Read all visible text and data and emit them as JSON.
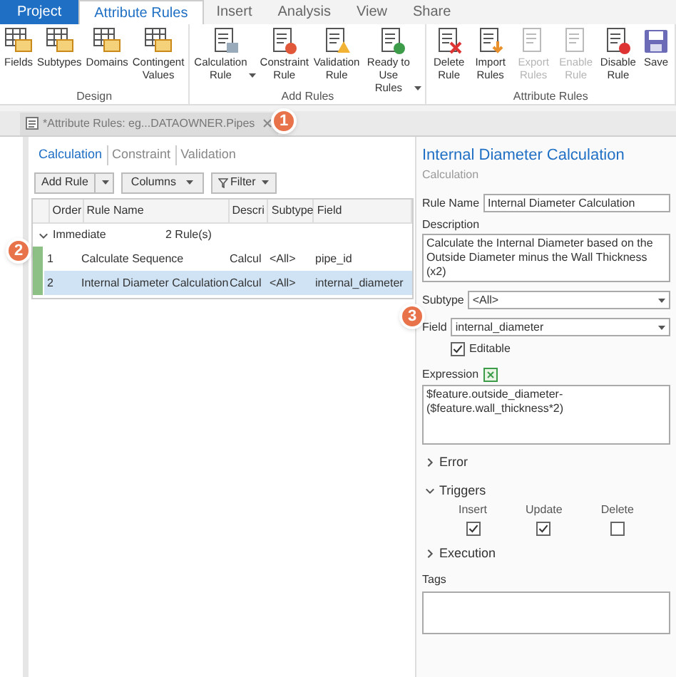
{
  "ribbon_tabs": [
    {
      "label": "Project",
      "selected": false,
      "kind": "file"
    },
    {
      "label": "Attribute Rules",
      "selected": true,
      "kind": "tab"
    },
    {
      "label": "Insert",
      "selected": false,
      "kind": "tab"
    },
    {
      "label": "Analysis",
      "selected": false,
      "kind": "tab"
    },
    {
      "label": "View",
      "selected": false,
      "kind": "tab"
    },
    {
      "label": "Share",
      "selected": false,
      "kind": "tab"
    }
  ],
  "ribbon_groups": [
    {
      "label": "Design",
      "buttons": [
        {
          "label": "Fields",
          "dropdown": false,
          "disabled": false
        },
        {
          "label": "Subtypes",
          "dropdown": false,
          "disabled": false
        },
        {
          "label": "Domains",
          "dropdown": false,
          "disabled": false
        },
        {
          "label": "Contingent Values",
          "dropdown": false,
          "disabled": false
        }
      ]
    },
    {
      "label": "Add Rules",
      "buttons": [
        {
          "label": "Calculation Rule",
          "dropdown": true,
          "disabled": false
        },
        {
          "label": "Constraint Rule",
          "dropdown": false,
          "disabled": false
        },
        {
          "label": "Validation Rule",
          "dropdown": false,
          "disabled": false
        },
        {
          "label": "Ready to Use Rules",
          "dropdown": true,
          "disabled": false
        }
      ]
    },
    {
      "label": "Attribute Rules",
      "buttons": [
        {
          "label": "Delete Rule",
          "dropdown": false,
          "disabled": false
        },
        {
          "label": "Import Rules",
          "dropdown": false,
          "disabled": false
        },
        {
          "label": "Export Rules",
          "dropdown": false,
          "disabled": true
        },
        {
          "label": "Enable Rule",
          "dropdown": false,
          "disabled": true
        },
        {
          "label": "Disable Rule",
          "dropdown": false,
          "disabled": false
        },
        {
          "label": "Save",
          "dropdown": false,
          "disabled": false
        }
      ]
    }
  ],
  "document_tab": {
    "title": "*Attribute Rules: eg...DATAOWNER.Pipes",
    "callout": "1"
  },
  "rule_tabs": [
    {
      "label": "Calculation",
      "selected": true
    },
    {
      "label": "Constraint",
      "selected": false
    },
    {
      "label": "Validation",
      "selected": false
    }
  ],
  "toolbar": {
    "add_rule": "Add Rule",
    "columns": "Columns",
    "filter": "Filter"
  },
  "table": {
    "columns": [
      "Order",
      "Rule Name",
      "Descri",
      "Subtype",
      "Field"
    ],
    "group": {
      "label": "Immediate",
      "count": "2 Rule(s)",
      "expanded": true
    },
    "callout": "2",
    "rows": [
      {
        "cells": [
          "1",
          "Calculate Sequence",
          "Calcul",
          "<All>",
          "pipe_id"
        ],
        "selected": false
      },
      {
        "cells": [
          "2",
          "Internal Diameter Calculation",
          "Calcul",
          "<All>",
          "internal_diameter"
        ],
        "selected": true
      }
    ]
  },
  "details": {
    "title": "Internal Diameter Calculation",
    "subtitle": "Calculation",
    "rule_name_label": "Rule Name",
    "rule_name": "Internal Diameter Calculation",
    "description_label": "Description",
    "description": "Calculate the Internal Diameter based on the Outside Diameter minus the Wall Thickness (x2)",
    "subtype_label": "Subtype",
    "subtype": "<All>",
    "field_label": "Field",
    "field": "internal_diameter",
    "field_callout": "3",
    "editable": {
      "label": "Editable",
      "checked": true
    },
    "expression_label": "Expression",
    "expression": "$feature.outside_diameter-\n($feature.wall_thickness*2)",
    "sections": [
      {
        "label": "Error",
        "expanded": false
      },
      {
        "label": "Triggers",
        "expanded": true,
        "options": [
          {
            "label": "Insert",
            "checked": true
          },
          {
            "label": "Update",
            "checked": true
          },
          {
            "label": "Delete",
            "checked": false
          }
        ]
      },
      {
        "label": "Execution",
        "expanded": false
      }
    ],
    "tags_label": "Tags"
  }
}
